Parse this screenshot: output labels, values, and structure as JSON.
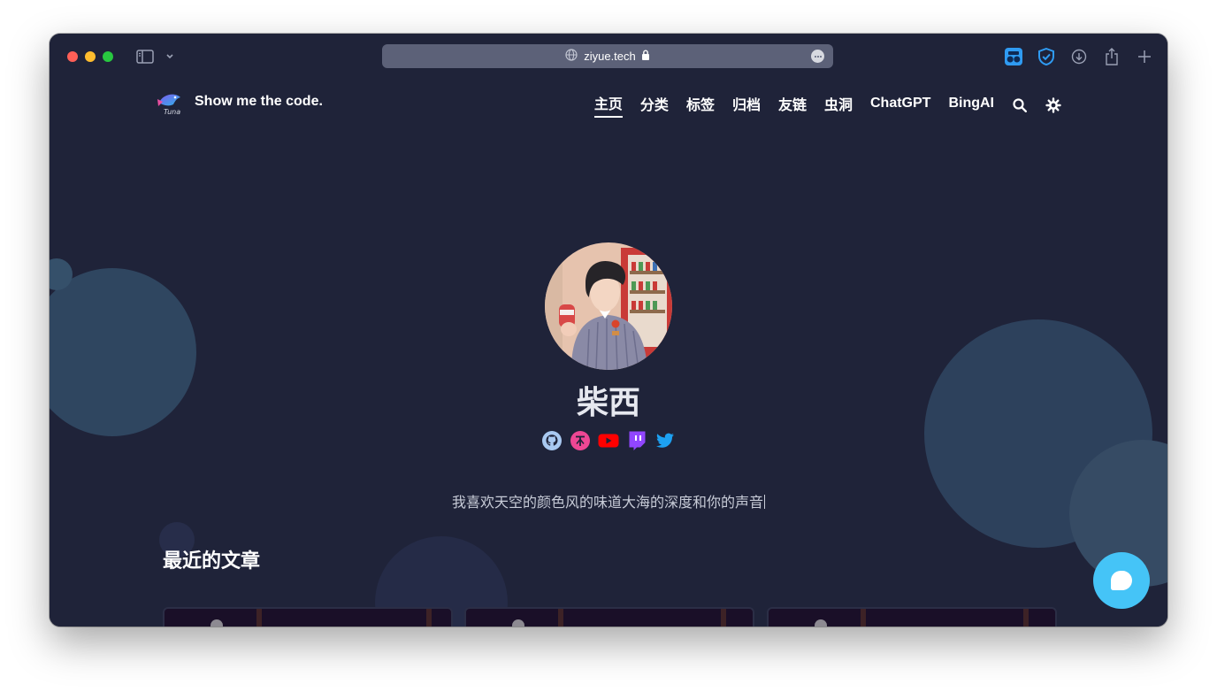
{
  "browser": {
    "url": "ziyue.tech",
    "icons": [
      "sidebar-icon",
      "chevron-down-icon",
      "globe-icon",
      "lock-icon",
      "more-icon",
      "tab-extension-icon",
      "shield-icon",
      "download-icon",
      "share-icon",
      "plus-icon"
    ]
  },
  "site": {
    "name": "Show me the code.",
    "logo_text": "Tuna"
  },
  "nav": {
    "items": [
      {
        "label": "主页",
        "active": true
      },
      {
        "label": "分类"
      },
      {
        "label": "标签"
      },
      {
        "label": "归档"
      },
      {
        "label": "友链"
      },
      {
        "label": "虫洞"
      },
      {
        "label": "ChatGPT"
      },
      {
        "label": "BingAI"
      }
    ]
  },
  "profile": {
    "name": "柴西",
    "tagline": "我喜欢天空的颜色风的味道大海的深度和你的声音",
    "socials": [
      "github-icon",
      "tiktok-icon",
      "youtube-icon",
      "twitch-icon",
      "twitter-icon"
    ]
  },
  "section": {
    "recent_posts": "最近的文章"
  },
  "colors": {
    "background": "#1f2339",
    "accent": "#45c4f7",
    "text": "#ffffff"
  }
}
